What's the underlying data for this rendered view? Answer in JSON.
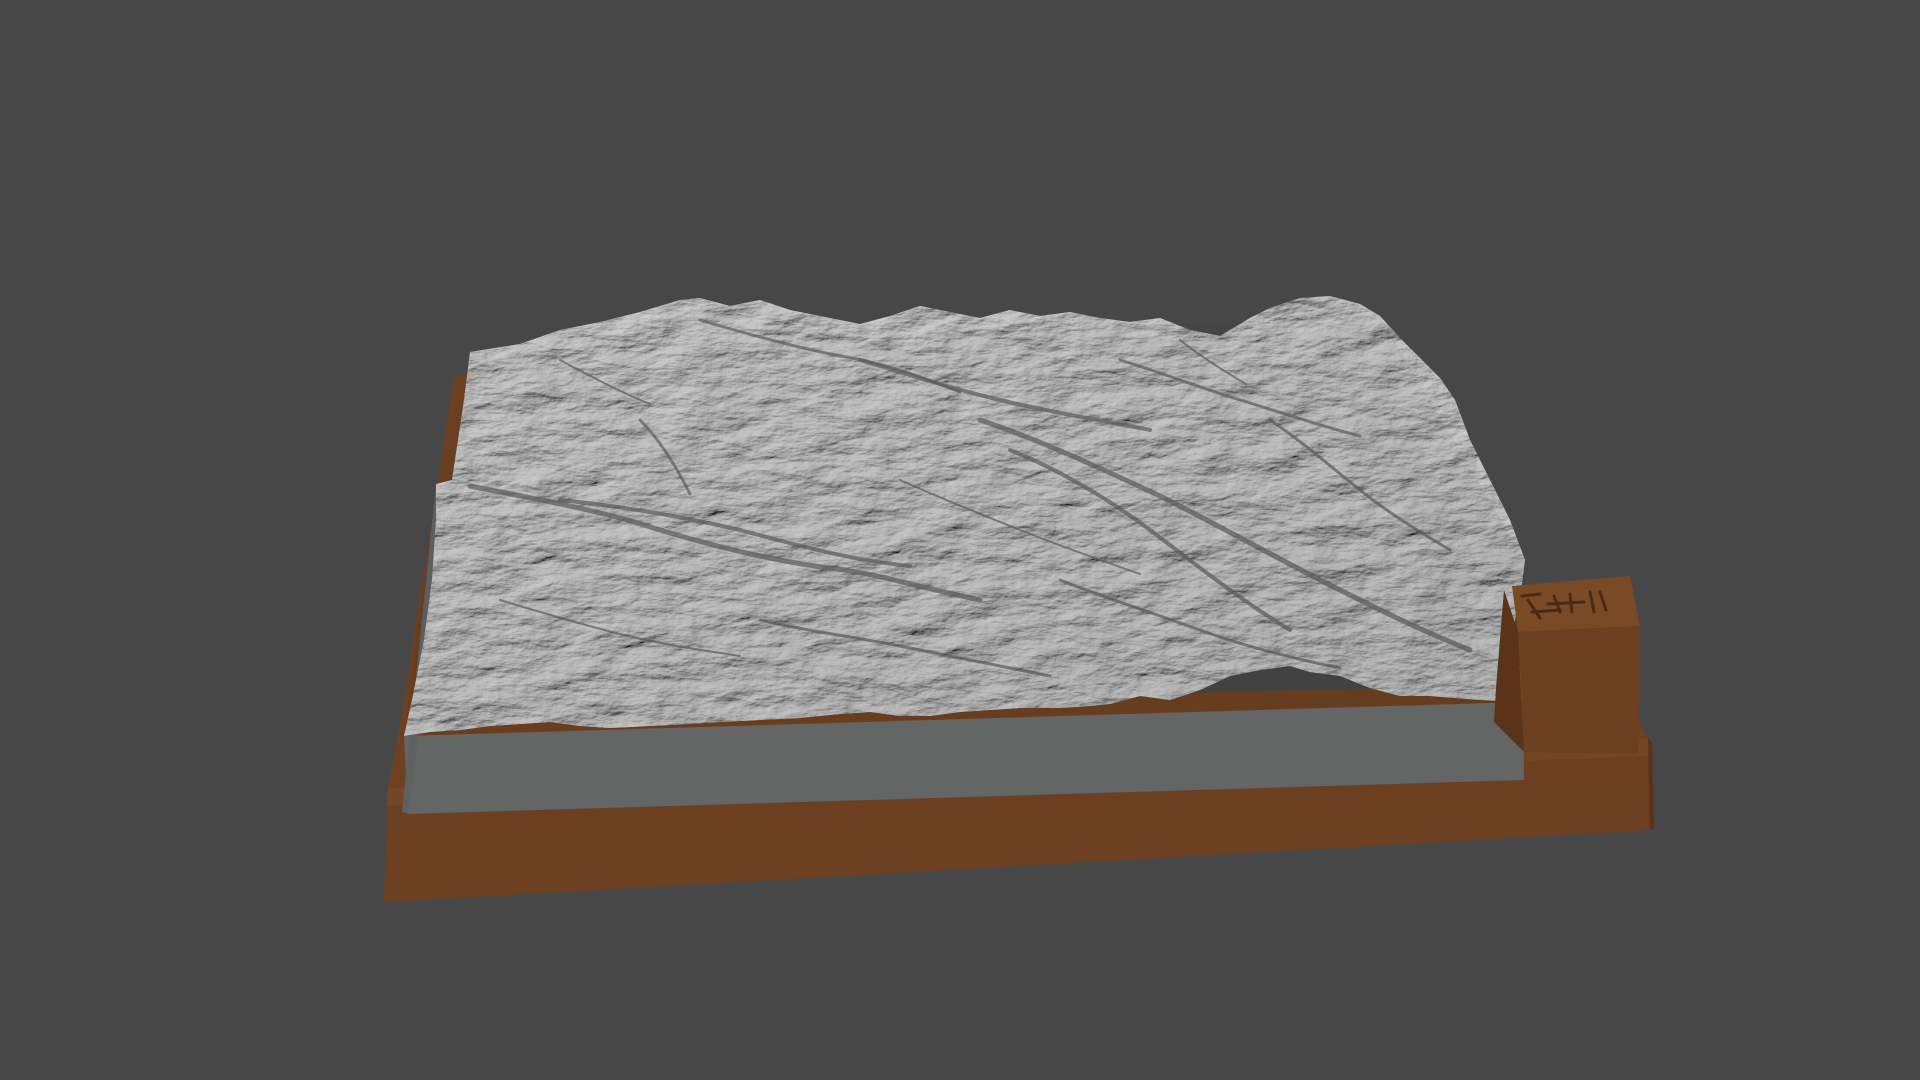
{
  "viewport": {
    "background_color": "#474747"
  },
  "model": {
    "terrain_color": "#a9a9a9",
    "terrain_side_color": "#646565",
    "base_color": "#6b3f20",
    "base_dark_color": "#5a3319",
    "corner_block_color": "#6e4121"
  }
}
